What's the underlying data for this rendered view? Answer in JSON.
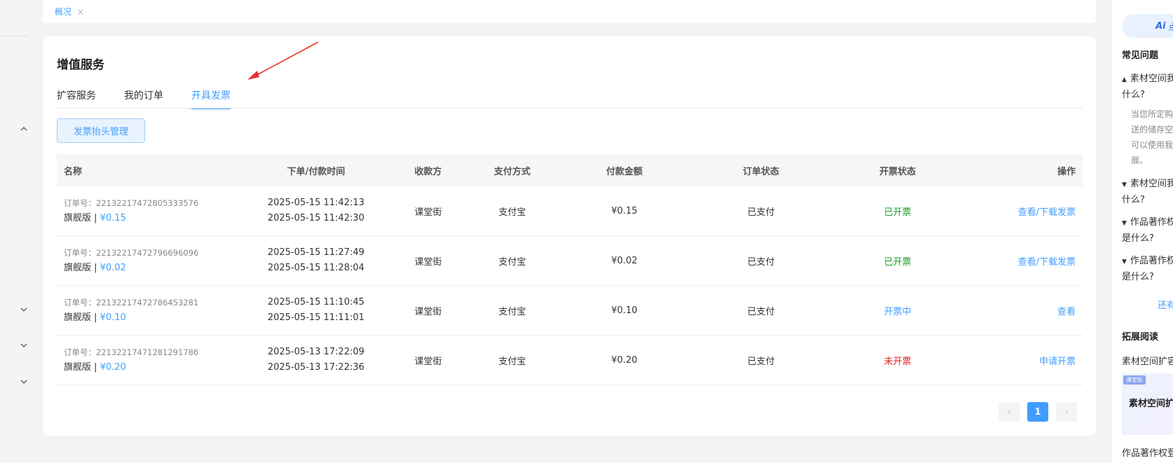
{
  "tabbar": {
    "tab_label": "概况",
    "close_glyph": "×"
  },
  "page": {
    "title": "增值服务",
    "sub_tabs": [
      {
        "label": "扩容服务"
      },
      {
        "label": "我的订单"
      },
      {
        "label": "开具发票"
      }
    ],
    "active_sub_tab": "开具发票",
    "title_mgmt_button": "发票抬头管理"
  },
  "table": {
    "headers": {
      "name": "名称",
      "time": "下单/付款时间",
      "payee": "收款方",
      "method": "支付方式",
      "amount": "付款金额",
      "order_status": "订单状态",
      "invoice_status": "开票状态",
      "operation": "操作"
    },
    "rows": [
      {
        "order_no": "订单号：22132217472805333576",
        "edition": "旗舰版",
        "sep": " | ",
        "price": "¥0.15",
        "order_time": "2025-05-15 11:42:13",
        "pay_time": "2025-05-15 11:42:30",
        "payee": "课堂街",
        "method": "支付宝",
        "amount": "¥0.15",
        "order_status": "已支付",
        "invoice_status": "已开票",
        "operation": "查看/下载发票"
      },
      {
        "order_no": "订单号：22132217472796696096",
        "edition": "旗舰版",
        "sep": " | ",
        "price": "¥0.02",
        "order_time": "2025-05-15 11:27:49",
        "pay_time": "2025-05-15 11:28:04",
        "payee": "课堂街",
        "method": "支付宝",
        "amount": "¥0.02",
        "order_status": "已支付",
        "invoice_status": "已开票",
        "operation": "查看/下载发票"
      },
      {
        "order_no": "订单号：22132217472786453281",
        "edition": "旗舰版",
        "sep": " | ",
        "price": "¥0.10",
        "order_time": "2025-05-15 11:10:45",
        "pay_time": "2025-05-15 11:11:01",
        "payee": "课堂街",
        "method": "支付宝",
        "amount": "¥0.10",
        "order_status": "已支付",
        "invoice_status": "开票中",
        "operation": "查看"
      },
      {
        "order_no": "订单号：22132217471281291786",
        "edition": "旗舰版",
        "sep": " | ",
        "price": "¥0.20",
        "order_time": "2025-05-13 17:22:09",
        "pay_time": "2025-05-13 17:22:36",
        "payee": "课堂街",
        "method": "支付宝",
        "amount": "¥0.20",
        "order_status": "已支付",
        "invoice_status": "未开票",
        "operation": "申请开票"
      }
    ]
  },
  "pagination": {
    "prev": "‹",
    "current": "1",
    "next": "›"
  },
  "right_panel": {
    "ai_label": "Ai",
    "ai_text": "点",
    "faq_heading": "常见问题",
    "q1": "素材空间我",
    "q1_cont": "什么?",
    "q1_answer": [
      "当您所定购",
      "送的储存空",
      "可以使用我",
      "展。"
    ],
    "q2": "素材空间我",
    "q2_cont": "什么?",
    "q3": "作品著作权",
    "q3_cont": "是什么?",
    "q4": "作品著作权",
    "q4_cont": "是什么?",
    "more": "还有",
    "ext_heading": "拓展阅读",
    "ext_item1": "素材空间扩容",
    "thumb_badge": "课堂街",
    "thumb_title": "素材空间扩",
    "ext_item2": "作品著作权登"
  },
  "colors": {
    "accent": "#409eff",
    "invoiced": "#1a9c2a",
    "not_invoiced": "#e02020",
    "arrow": "#e8322b"
  }
}
